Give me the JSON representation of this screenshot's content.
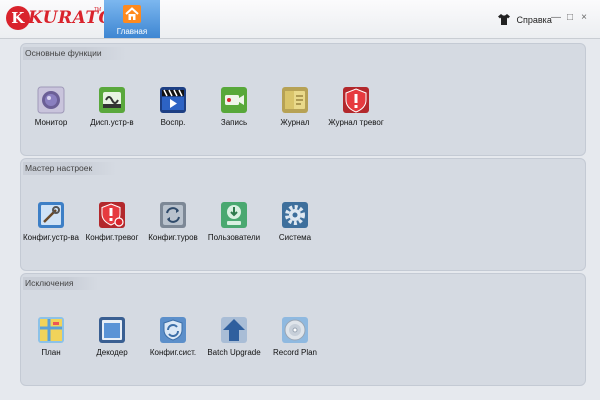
{
  "header": {
    "logo_text": "KURATO",
    "logo_tm": "TM",
    "home_tab_label": "Главная",
    "help_label": "Справка",
    "window_controls": [
      "—",
      "□",
      "×"
    ]
  },
  "sections": [
    {
      "title": "Основные функции",
      "items": [
        {
          "label": "Монитор",
          "icon": "monitor-camera-icon"
        },
        {
          "label": "Дисп.устр-в",
          "icon": "device-manager-icon"
        },
        {
          "label": "Воспр.",
          "icon": "playback-clapper-icon"
        },
        {
          "label": "Запись",
          "icon": "record-icon"
        },
        {
          "label": "Журнал",
          "icon": "log-book-icon"
        },
        {
          "label": "Журнал тревог",
          "icon": "alarm-log-shield-icon"
        }
      ]
    },
    {
      "title": "Мастер настроек",
      "items": [
        {
          "label": "Конфиг.устр-ва",
          "icon": "device-config-icon"
        },
        {
          "label": "Конфиг.тревог",
          "icon": "alarm-config-shield-icon"
        },
        {
          "label": "Конфиг.туров",
          "icon": "tour-config-icon"
        },
        {
          "label": "Пользователи",
          "icon": "users-icon"
        },
        {
          "label": "Система",
          "icon": "system-gear-icon"
        }
      ]
    },
    {
      "title": "Исключения",
      "items": [
        {
          "label": "План",
          "icon": "plan-map-icon"
        },
        {
          "label": "Декодер",
          "icon": "decoder-window-icon"
        },
        {
          "label": "Конфиг.сист.",
          "icon": "system-config-icon"
        },
        {
          "label": "Batch Upgrade",
          "icon": "batch-upgrade-arrow-icon"
        },
        {
          "label": "Record Plan",
          "icon": "record-plan-disc-icon"
        }
      ]
    }
  ]
}
